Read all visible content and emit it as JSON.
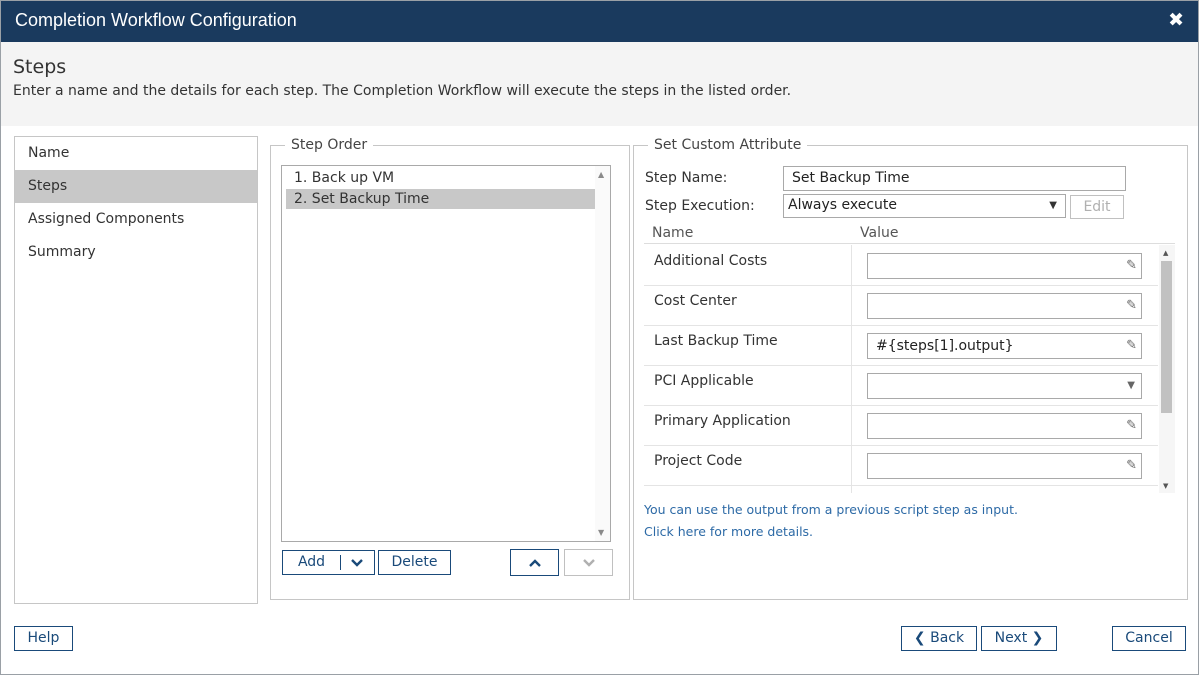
{
  "window": {
    "title": "Completion Workflow Configuration",
    "close_icon": "✖"
  },
  "header": {
    "title": "Steps",
    "description": "Enter a name and the details for each step. The Completion Workflow will execute the steps in the listed order."
  },
  "nav": {
    "items": [
      {
        "label": "Name",
        "active": false
      },
      {
        "label": "Steps",
        "active": true
      },
      {
        "label": "Assigned Components",
        "active": false
      },
      {
        "label": "Summary",
        "active": false
      }
    ]
  },
  "step_order": {
    "legend": "Step Order",
    "steps": [
      {
        "label": "1. Back up VM",
        "selected": false
      },
      {
        "label": "2. Set Backup Time",
        "selected": true
      }
    ],
    "add_label": "Add",
    "delete_label": "Delete"
  },
  "attribute": {
    "legend": "Set Custom Attribute",
    "step_name_label": "Step Name:",
    "step_name_value": "Set Backup Time",
    "step_execution_label": "Step Execution:",
    "step_execution_value": "Always execute",
    "edit_label": "Edit",
    "col_name": "Name",
    "col_value": "Value",
    "rows": [
      {
        "name": "Additional Costs",
        "value": "",
        "kind": "text"
      },
      {
        "name": "Cost Center",
        "value": "",
        "kind": "text"
      },
      {
        "name": "Last Backup Time",
        "value": "#{steps[1].output}",
        "kind": "text"
      },
      {
        "name": "PCI Applicable",
        "value": "",
        "kind": "select"
      },
      {
        "name": "Primary Application",
        "value": "",
        "kind": "text"
      },
      {
        "name": "Project Code",
        "value": "",
        "kind": "text"
      },
      {
        "name": "",
        "value": "",
        "kind": "text"
      }
    ],
    "hint": "You can use the output from a previous script step as input.",
    "hint_link": "Click here for more details."
  },
  "footer": {
    "help_label": "Help",
    "back_label": "Back",
    "next_label": "Next",
    "cancel_label": "Cancel"
  },
  "colors": {
    "titlebar": "#1a3a5e",
    "accent": "#1a4a7a",
    "link": "#2d6aa6",
    "selected_row": "#c8c8c8"
  }
}
